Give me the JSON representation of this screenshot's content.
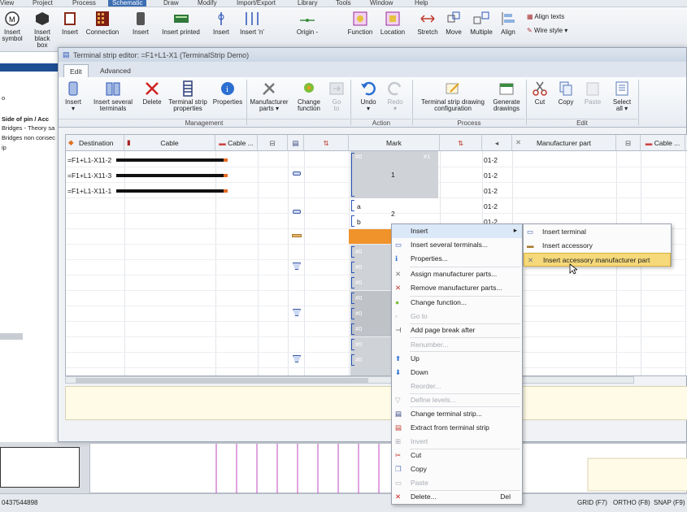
{
  "app_menu": {
    "items": [
      "View",
      "Project",
      "Process",
      "Schematic",
      "Draw",
      "Modify",
      "Import/Export",
      "Library",
      "Tools",
      "Window",
      "Help"
    ],
    "active": "Schematic"
  },
  "app_ribbon": {
    "buttons": [
      {
        "label": "Insert\nsymbol",
        "icon": "symbol-icon"
      },
      {
        "label": "Insert\nblack box",
        "icon": "black-box-icon"
      },
      {
        "label": "Insert",
        "icon": "insert-icon"
      },
      {
        "label": "Connection",
        "icon": "connection-icon"
      },
      {
        "label": "Insert",
        "icon": "insert-icon"
      },
      {
        "label": "Insert printed",
        "icon": "printed-icon"
      },
      {
        "label": "Insert",
        "icon": "insert-icon"
      },
      {
        "label": "Insert 'n'",
        "icon": "insert-n-icon"
      },
      {
        "label": "Origin -",
        "icon": "origin-icon"
      },
      {
        "label": "Function",
        "icon": "function-icon"
      },
      {
        "label": "Location",
        "icon": "location-icon"
      },
      {
        "label": "Stretch",
        "icon": "stretch-icon"
      },
      {
        "label": "Move",
        "icon": "move-icon"
      },
      {
        "label": "Multiple",
        "icon": "multiple-icon"
      },
      {
        "label": "Align",
        "icon": "align-icon"
      }
    ],
    "align_texts": "Align texts",
    "wire_style": "Wire style"
  },
  "left_panel": {
    "lines": [
      "o",
      "",
      "Side of pin / Acc",
      "Bridges - Theory sa",
      "Bridges non consec",
      "ip"
    ]
  },
  "editor": {
    "title": "Terminal strip editor: =F1+L1-X1 (TerminalStrip Demo)",
    "tabs": [
      "Edit",
      "Advanced"
    ],
    "ribbon": {
      "groups": [
        {
          "name": "Management",
          "buttons": [
            {
              "label": "Insert",
              "sub": "▾",
              "icon": "insert-icon",
              "enabled": true
            },
            {
              "label": "Insert several",
              "sub": "terminals",
              "icon": "insert-several-icon",
              "enabled": true
            },
            {
              "label": "Delete",
              "sub": "",
              "icon": "delete-icon",
              "enabled": true
            },
            {
              "label": "Terminal strip",
              "sub": "properties",
              "icon": "terminal-strip-icon",
              "enabled": true
            },
            {
              "label": "Properties",
              "sub": "",
              "icon": "properties-icon",
              "enabled": true
            },
            {
              "label": "Manufacturer",
              "sub": "parts ▾",
              "icon": "manufacturer-icon",
              "enabled": true
            },
            {
              "label": "Change",
              "sub": "function",
              "icon": "change-function-icon",
              "enabled": true
            },
            {
              "label": "Go",
              "sub": "to",
              "icon": "goto-icon",
              "enabled": false
            }
          ]
        },
        {
          "name": "Action",
          "buttons": [
            {
              "label": "Undo",
              "sub": "▾",
              "icon": "undo-icon",
              "enabled": true
            },
            {
              "label": "Redo",
              "sub": "▾",
              "icon": "redo-icon",
              "enabled": false
            }
          ]
        },
        {
          "name": "Process",
          "buttons": [
            {
              "label": "Terminal strip drawing",
              "sub": "configuration",
              "icon": "drawing-config-icon",
              "enabled": true
            },
            {
              "label": "Generate",
              "sub": "drawings",
              "icon": "generate-icon",
              "enabled": true
            }
          ]
        },
        {
          "name": "Edit",
          "buttons": [
            {
              "label": "Cut",
              "sub": "",
              "icon": "cut-icon",
              "enabled": true
            },
            {
              "label": "Copy",
              "sub": "",
              "icon": "copy-icon",
              "enabled": true
            },
            {
              "label": "Paste",
              "sub": "",
              "icon": "paste-icon",
              "enabled": false
            },
            {
              "label": "Select",
              "sub": "all ▾",
              "icon": "select-all-icon",
              "enabled": true
            }
          ]
        }
      ]
    },
    "grid": {
      "columns": [
        "Destination",
        "Cable",
        "Cable ...",
        "",
        "",
        "",
        "Mark",
        "",
        "",
        "Manufacturer part",
        "",
        "Cable ..."
      ],
      "rows": [
        {
          "destination": "=F1+L1-X11-2",
          "cable": true,
          "mark": "",
          "part": "01-2"
        },
        {
          "destination": "=F1+L1-X11-3",
          "cable": true,
          "mark": "1",
          "part": "01-2"
        },
        {
          "destination": "=F1+L1-X11-1",
          "cable": true,
          "mark": "",
          "part": "01-2"
        },
        {
          "destination": "",
          "cable": false,
          "mark": "a",
          "part": "01-2"
        },
        {
          "destination": "",
          "cable": false,
          "mark": "b",
          "part": "01-2"
        }
      ],
      "mark_group_label": "2",
      "tags": [
        "#0",
        "#1",
        "#0",
        "#0",
        "#0",
        "#0",
        "#0",
        "#0",
        "#0",
        "#0"
      ]
    }
  },
  "context_menu": {
    "items": [
      {
        "label": "Insert",
        "icon": "",
        "enabled": true,
        "submenu": true
      },
      {
        "label": "Insert several terminals...",
        "icon": "insert-several-icon",
        "enabled": true
      },
      {
        "label": "Properties...",
        "icon": "properties-icon",
        "enabled": true
      },
      {
        "label": "Assign manufacturer parts...",
        "icon": "assign-parts-icon",
        "enabled": true
      },
      {
        "label": "Remove manufacturer parts...",
        "icon": "remove-parts-icon",
        "enabled": true
      },
      {
        "label": "Change function...",
        "icon": "change-function-icon",
        "enabled": true
      },
      {
        "label": "Go to",
        "icon": "goto-icon",
        "enabled": false
      },
      {
        "label": "Add page break after",
        "icon": "page-break-icon",
        "enabled": true
      },
      {
        "label": "Renumber...",
        "icon": "",
        "enabled": false
      },
      {
        "label": "Up",
        "icon": "up-icon",
        "enabled": true
      },
      {
        "label": "Down",
        "icon": "down-icon",
        "enabled": true
      },
      {
        "label": "Reorder...",
        "icon": "",
        "enabled": false
      },
      {
        "label": "Define levels...",
        "icon": "levels-icon",
        "enabled": false
      },
      {
        "label": "Change terminal strip...",
        "icon": "change-strip-icon",
        "enabled": true
      },
      {
        "label": "Extract from terminal strip",
        "icon": "extract-icon",
        "enabled": true
      },
      {
        "label": "Invert",
        "icon": "invert-icon",
        "enabled": false
      },
      {
        "label": "Cut",
        "icon": "cut-icon",
        "enabled": true
      },
      {
        "label": "Copy",
        "icon": "copy-icon",
        "enabled": true
      },
      {
        "label": "Paste",
        "icon": "paste-icon",
        "enabled": false
      },
      {
        "label": "Delete...",
        "icon": "delete-icon",
        "enabled": true,
        "shortcut": "Del"
      }
    ]
  },
  "submenu": {
    "items": [
      {
        "label": "Insert terminal",
        "icon": "terminal-icon"
      },
      {
        "label": "Insert accessory",
        "icon": "accessory-icon"
      },
      {
        "label": "Insert accessory manufacturer part",
        "icon": "accessory-part-icon",
        "selected": true
      }
    ]
  },
  "status_bar": {
    "coords": "0437544898",
    "grid": "GRID (F7)",
    "ortho": "ORTHO (F8)",
    "snap": "SNAP (F9)"
  },
  "colors": {
    "accent": "#3d6fb3",
    "wire": "#111111",
    "wire_end": "#e56a24",
    "selection": "#f5d97a",
    "orange_row": "#f0932b"
  }
}
